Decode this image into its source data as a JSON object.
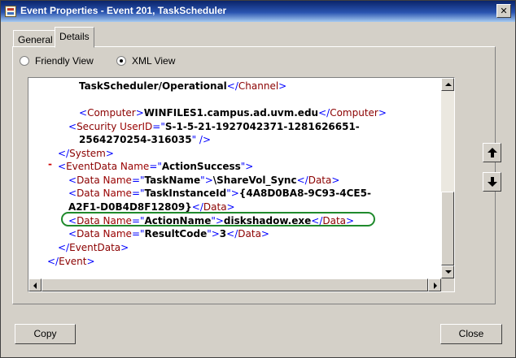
{
  "window": {
    "title": "Event Properties - Event 201, TaskScheduler",
    "close_glyph": "✕"
  },
  "tabs": [
    {
      "label": "General"
    },
    {
      "label": "Details"
    }
  ],
  "view_options": {
    "friendly": {
      "label": "Friendly View",
      "selected": false
    },
    "xml": {
      "label": "XML View",
      "selected": true
    }
  },
  "xml_lines": [
    {
      "indent": 0,
      "parts": [
        {
          "t": "TaskScheduler/Operational",
          "c": "txtc"
        },
        {
          "t": "</",
          "c": "brk"
        },
        {
          "t": "Channel",
          "c": "tagc"
        },
        {
          "t": ">",
          "c": "brk"
        }
      ]
    },
    {
      "indent": 0,
      "parts": []
    },
    {
      "indent": 0,
      "parts": [
        {
          "t": "<",
          "c": "brk"
        },
        {
          "t": "Computer",
          "c": "tagc"
        },
        {
          "t": ">",
          "c": "brk"
        },
        {
          "t": "WINFILES1.campus.ad.uvm.edu",
          "c": "txtc"
        },
        {
          "t": "</",
          "c": "brk"
        },
        {
          "t": "Computer",
          "c": "tagc"
        },
        {
          "t": ">",
          "c": "brk"
        }
      ]
    },
    {
      "indent": -1,
      "parts": [
        {
          "t": "<",
          "c": "brk"
        },
        {
          "t": "Security ",
          "c": "tagc"
        },
        {
          "t": "UserID",
          "c": "attc"
        },
        {
          "t": "=\"",
          "c": "brk"
        },
        {
          "t": "S-1-5-21-1927042371-1281626651-",
          "c": "valc"
        }
      ]
    },
    {
      "indent": 0,
      "parts": [
        {
          "t": "2564270254-316035",
          "c": "valc"
        },
        {
          "t": "\" />",
          "c": "brk"
        }
      ]
    },
    {
      "indent": -2,
      "parts": [
        {
          "t": "</",
          "c": "brk"
        },
        {
          "t": "System",
          "c": "tagc"
        },
        {
          "t": ">",
          "c": "brk"
        }
      ]
    },
    {
      "indent": -2,
      "parts": [
        {
          "t": "<",
          "c": "brk"
        },
        {
          "t": "EventData ",
          "c": "tagc"
        },
        {
          "t": "Name",
          "c": "attc"
        },
        {
          "t": "=\"",
          "c": "brk"
        },
        {
          "t": "ActionSuccess",
          "c": "valc"
        },
        {
          "t": "\">",
          "c": "brk"
        }
      ]
    },
    {
      "indent": -1,
      "parts": [
        {
          "t": "<",
          "c": "brk"
        },
        {
          "t": "Data ",
          "c": "tagc"
        },
        {
          "t": "Name",
          "c": "attc"
        },
        {
          "t": "=\"",
          "c": "brk"
        },
        {
          "t": "TaskName",
          "c": "valc"
        },
        {
          "t": "\">",
          "c": "brk"
        },
        {
          "t": "\\ShareVol_Sync",
          "c": "txtc"
        },
        {
          "t": "</",
          "c": "brk"
        },
        {
          "t": "Data",
          "c": "tagc"
        },
        {
          "t": ">",
          "c": "brk"
        }
      ]
    },
    {
      "indent": -1,
      "parts": [
        {
          "t": "<",
          "c": "brk"
        },
        {
          "t": "Data ",
          "c": "tagc"
        },
        {
          "t": "Name",
          "c": "attc"
        },
        {
          "t": "=\"",
          "c": "brk"
        },
        {
          "t": "TaskInstanceId",
          "c": "valc"
        },
        {
          "t": "\">",
          "c": "brk"
        },
        {
          "t": "{4A8D0BA8-9C93-4CE5-",
          "c": "txtc"
        }
      ]
    },
    {
      "indent": -1,
      "parts": [
        {
          "t": "A2F1-D0B4D8F12809}",
          "c": "txtc"
        },
        {
          "t": "</",
          "c": "brk"
        },
        {
          "t": "Data",
          "c": "tagc"
        },
        {
          "t": ">",
          "c": "brk"
        }
      ]
    },
    {
      "indent": -1,
      "parts": [
        {
          "t": "<",
          "c": "brk"
        },
        {
          "t": "Data ",
          "c": "tagc"
        },
        {
          "t": "Name",
          "c": "attc"
        },
        {
          "t": "=\"",
          "c": "brk"
        },
        {
          "t": "ActionName",
          "c": "valc"
        },
        {
          "t": "\">",
          "c": "brk"
        },
        {
          "t": "diskshadow.exe",
          "c": "txtc"
        },
        {
          "t": "</",
          "c": "brk"
        },
        {
          "t": "Data",
          "c": "tagc"
        },
        {
          "t": ">",
          "c": "brk"
        }
      ]
    },
    {
      "indent": -1,
      "parts": [
        {
          "t": "<",
          "c": "brk"
        },
        {
          "t": "Data ",
          "c": "tagc"
        },
        {
          "t": "Name",
          "c": "attc"
        },
        {
          "t": "=\"",
          "c": "brk"
        },
        {
          "t": "ResultCode",
          "c": "valc"
        },
        {
          "t": "\">",
          "c": "brk"
        },
        {
          "t": "3",
          "c": "txtc"
        },
        {
          "t": "</",
          "c": "brk"
        },
        {
          "t": "Data",
          "c": "tagc"
        },
        {
          "t": ">",
          "c": "brk"
        }
      ]
    },
    {
      "indent": -2,
      "parts": [
        {
          "t": "</",
          "c": "brk"
        },
        {
          "t": "EventData",
          "c": "tagc"
        },
        {
          "t": ">",
          "c": "brk"
        }
      ]
    },
    {
      "indent": -3,
      "parts": [
        {
          "t": "</",
          "c": "brk"
        },
        {
          "t": "Event",
          "c": "tagc"
        },
        {
          "t": ">",
          "c": "brk"
        }
      ]
    }
  ],
  "collapse_marker": "-",
  "buttons": {
    "copy": "Copy",
    "close": "Close"
  },
  "nav": {
    "up": "arrow-up-icon",
    "down": "arrow-down-icon"
  },
  "colors": {
    "highlight": "#1f8a2c",
    "tag": "#8b0000",
    "bracket": "#0000ff",
    "title_bar": "#0a246a"
  }
}
